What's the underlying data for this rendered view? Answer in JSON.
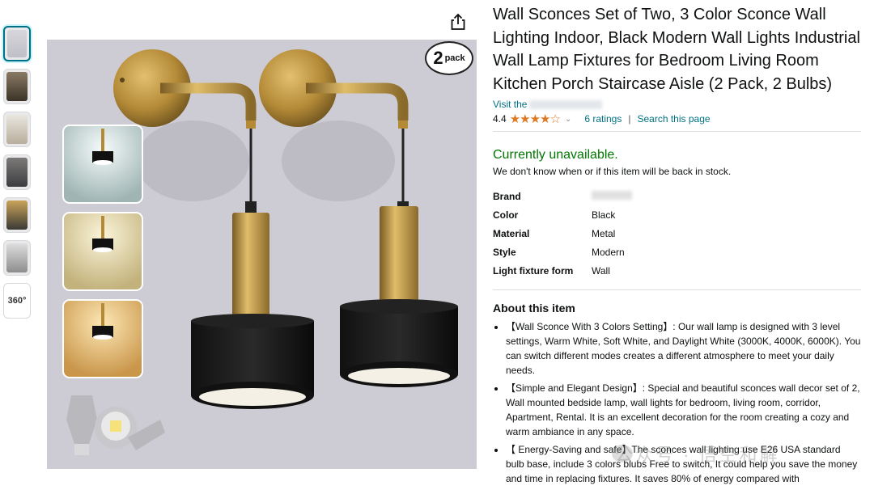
{
  "thumbnails": [
    {
      "kind": "image",
      "selected": true
    },
    {
      "kind": "image",
      "selected": false
    },
    {
      "kind": "image",
      "selected": false
    },
    {
      "kind": "image",
      "selected": false
    },
    {
      "kind": "image",
      "selected": false
    },
    {
      "kind": "image",
      "selected": false
    },
    {
      "kind": "360",
      "label": "360°"
    }
  ],
  "share_icon": "share-icon",
  "product_image": {
    "badge_number": "2",
    "badge_text": "pack"
  },
  "product": {
    "title": "Wall Sconces Set of Two, 3 Color Sconce Wall Lighting Indoor, Black Modern Wall Lights Industrial Wall Lamp Fixtures for Bedroom Living Room Kitchen Porch Staircase Aisle (2 Pack, 2 Bulbs)",
    "store_prefix": "Visit the",
    "rating_value": "4.4",
    "rating_stars": "★★★★☆",
    "rating_count": "6 ratings",
    "search_page": "Search this page"
  },
  "availability": {
    "status": "Currently unavailable.",
    "message": "We don't know when or if this item will be back in stock."
  },
  "specs": [
    {
      "key": "Brand",
      "value": ""
    },
    {
      "key": "Color",
      "value": "Black"
    },
    {
      "key": "Material",
      "value": "Metal"
    },
    {
      "key": "Style",
      "value": "Modern"
    },
    {
      "key": "Light fixture form",
      "value": "Wall"
    }
  ],
  "about": {
    "heading": "About this item",
    "bullets": [
      "【Wall Sconce With 3 Colors Setting】: Our wall lamp is designed with 3 level settings, Warm White, Soft White, and Daylight White (3000K, 4000K, 6000K). You can switch different modes creates a different atmosphere to meet your daily needs.",
      "【Simple and Elegant Design】: Special and beautiful sconces wall decor set of 2, Wall mounted bedside lamp, wall lights for bedroom, living room, corridor, Apartment, Rental. It is an excellent decoration for the room creating a cozy and warm ambiance in any space.",
      "【 Energy-Saving and safe】The sconces wall lighting use E26 USA standard bulb base, include 3 colors blubs Free to switch, It could help you save the money and time in replacing fixtures. It saves 80% of energy compared with"
    ]
  },
  "watermark": "公众号 · 悟空和解",
  "colors": {
    "link": "#007185",
    "available": "#007600",
    "star": "#de7921"
  }
}
